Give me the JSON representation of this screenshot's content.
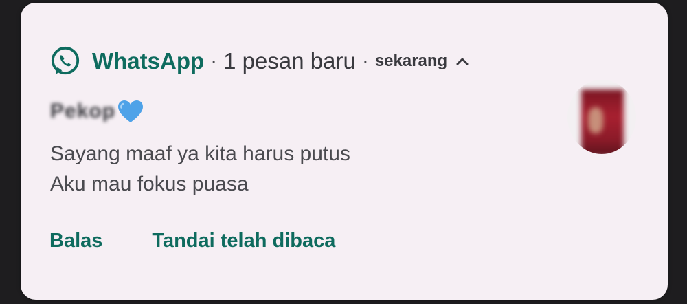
{
  "notification": {
    "app_name": "WhatsApp",
    "separator": "·",
    "message_count": "1 pesan baru",
    "time": "sekarang",
    "sender_name": "Pekop",
    "message_lines": [
      "Sayang maaf ya kita harus putus",
      "Aku mau fokus puasa"
    ],
    "actions": {
      "reply": "Balas",
      "mark_read": "Tandai telah dibaca"
    }
  },
  "colors": {
    "accent": "#0e6b5e",
    "card_background": "#f6eff4",
    "screen_background": "#1e1d1f",
    "heart": "#4ea2e8"
  },
  "icons": {
    "app": "whatsapp-icon",
    "expand": "chevron-up-icon",
    "emoji": "blue-heart-icon"
  }
}
